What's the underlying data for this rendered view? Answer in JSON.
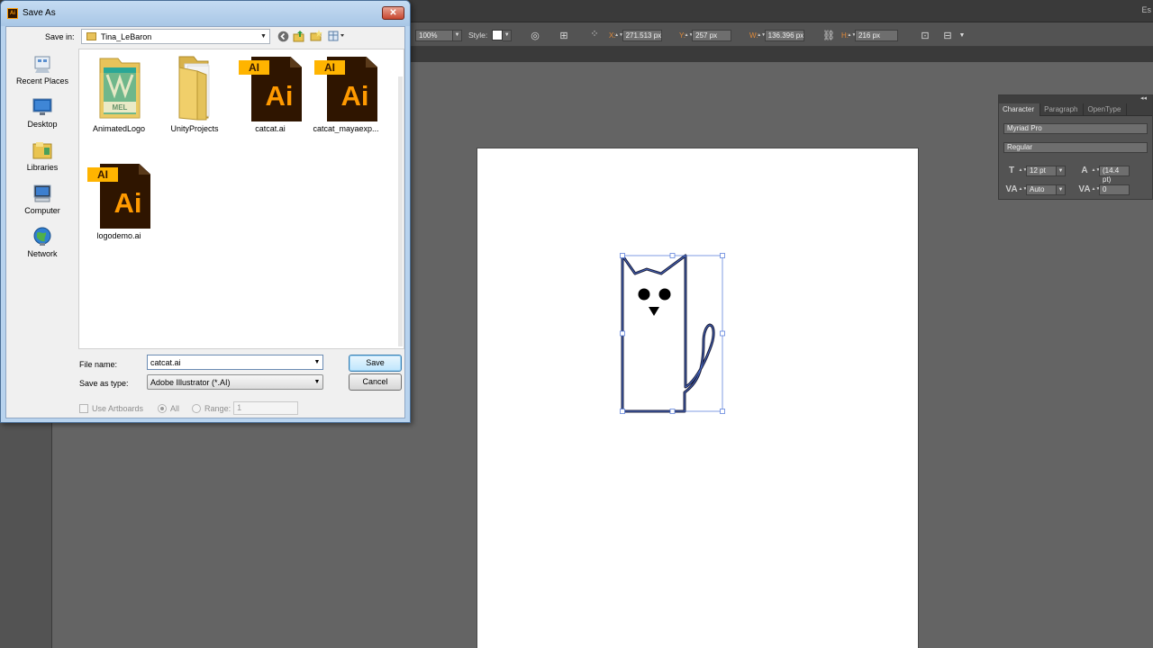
{
  "illustrator": {
    "menubar_right_text": "Es",
    "control_bar": {
      "zoom_value": "100%",
      "style_label": "Style:",
      "x_label": "X:",
      "x_value": "271.513 px",
      "y_label": "Y:",
      "y_value": "257 px",
      "w_label": "W:",
      "w_value": "136.396 px",
      "h_label": "H:",
      "h_value": "216 px"
    },
    "character_panel": {
      "tabs": [
        "Character",
        "Paragraph",
        "OpenType"
      ],
      "font_family": "Myriad Pro",
      "font_style": "Regular",
      "font_size": "12 pt",
      "leading": "(14.4 pt)",
      "kerning": "Auto",
      "tracking": "0"
    },
    "colors": {
      "canvas_bg": "#646464",
      "artboard": "#ffffff",
      "selection": "#3a60c8",
      "label_orange": "#e08a3a"
    }
  },
  "dialog": {
    "title": "Save As",
    "save_in_label": "Save in:",
    "save_in_value": "Tina_LeBaron",
    "places": [
      {
        "label": "Recent Places",
        "icon": "recent-places-icon"
      },
      {
        "label": "Desktop",
        "icon": "desktop-icon"
      },
      {
        "label": "Libraries",
        "icon": "libraries-icon"
      },
      {
        "label": "Computer",
        "icon": "computer-icon"
      },
      {
        "label": "Network",
        "icon": "network-icon"
      }
    ],
    "files": [
      {
        "name": "AnimatedLogo",
        "kind": "maya-folder"
      },
      {
        "name": "UnityProjects",
        "kind": "folder"
      },
      {
        "name": "catcat.ai",
        "kind": "ai"
      },
      {
        "name": "catcat_mayaexp...",
        "kind": "ai"
      },
      {
        "name": "logodemo.ai",
        "kind": "ai"
      }
    ],
    "ai_tag": "AI",
    "ai_big": "Ai",
    "maya_tag": "MEL",
    "file_name_label": "File name:",
    "file_name_value": "catcat.ai",
    "save_as_type_label": "Save as type:",
    "save_as_type_value": "Adobe Illustrator (*.AI)",
    "save_button": "Save",
    "cancel_button": "Cancel",
    "use_artboards_label": "Use Artboards",
    "all_label": "All",
    "range_label": "Range:",
    "range_value": "1"
  }
}
